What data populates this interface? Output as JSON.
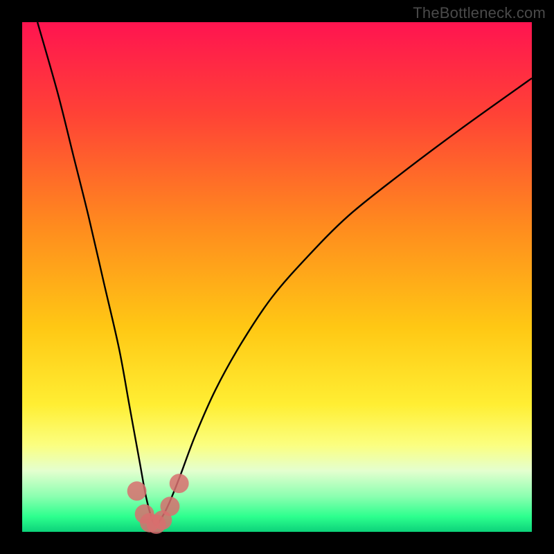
{
  "watermark": "TheBottleneck.com",
  "colors": {
    "frame": "#000000",
    "curve": "#000000",
    "marker_fill": "#d86e6e",
    "marker_stroke": "#d86e6e"
  },
  "gradient_stops": [
    {
      "pct": 0,
      "color": "#ff1450"
    },
    {
      "pct": 18,
      "color": "#ff4236"
    },
    {
      "pct": 40,
      "color": "#ff8b1e"
    },
    {
      "pct": 60,
      "color": "#ffc814"
    },
    {
      "pct": 75,
      "color": "#ffee33"
    },
    {
      "pct": 83,
      "color": "#fbff80"
    },
    {
      "pct": 88,
      "color": "#e4ffcf"
    },
    {
      "pct": 93,
      "color": "#8cffb0"
    },
    {
      "pct": 97,
      "color": "#2dff8e"
    },
    {
      "pct": 100,
      "color": "#0cd27a"
    }
  ],
  "chart_data": {
    "type": "line",
    "title": "",
    "xlabel": "",
    "ylabel": "",
    "xlim": [
      0,
      100
    ],
    "ylim": [
      0,
      100
    ],
    "note": "Axes are unlabeled in the source image; x and y are normalized 0–100 from the plot bounds. y=0 is the green bottom band, y=100 is the red top. The curve is a V/U shape whose minimum sits near x≈26, y≈0, with a handful of pinkish markers clustered around the trough.",
    "series": [
      {
        "name": "curve",
        "x": [
          3,
          7,
          10,
          13,
          16,
          19,
          21,
          23,
          24.5,
          26,
          27.5,
          29,
          31,
          34,
          38,
          43,
          49,
          56,
          64,
          74,
          86,
          100
        ],
        "y": [
          100,
          86,
          74,
          62,
          49,
          36,
          25,
          14,
          6,
          1.5,
          3,
          6,
          11,
          19,
          28,
          37,
          46,
          54,
          62,
          70,
          79,
          89
        ]
      }
    ],
    "markers": [
      {
        "x": 22.5,
        "y": 8,
        "r": 1.5
      },
      {
        "x": 24.0,
        "y": 3.5,
        "r": 1.5
      },
      {
        "x": 25.0,
        "y": 1.8,
        "r": 1.5
      },
      {
        "x": 26.3,
        "y": 1.5,
        "r": 1.5
      },
      {
        "x": 27.5,
        "y": 2.3,
        "r": 1.5
      },
      {
        "x": 29.0,
        "y": 5.0,
        "r": 1.5
      },
      {
        "x": 30.8,
        "y": 9.5,
        "r": 1.5
      }
    ]
  }
}
